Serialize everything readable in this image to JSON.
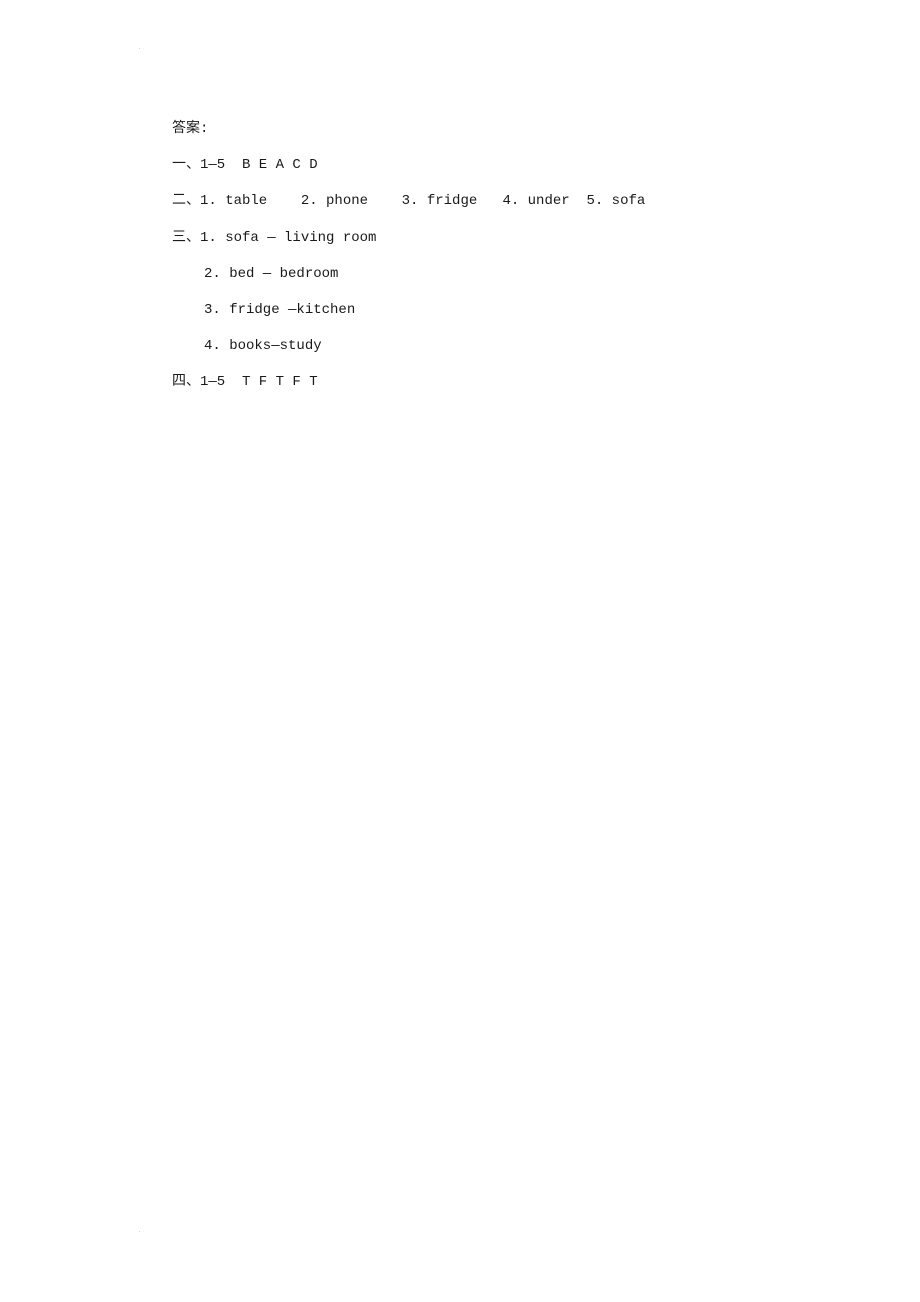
{
  "document": {
    "heading": "答案:",
    "sections": [
      {
        "label": "一、",
        "text": "1—5  B E A C D"
      },
      {
        "label": "二、",
        "text": "1. table    2. phone    3. fridge   4. under  5. sofa"
      },
      {
        "label": "三、",
        "text": "1. sofa — living room"
      },
      {
        "label": "",
        "text": "2. bed — bedroom"
      },
      {
        "label": "",
        "text": "3. fridge —kitchen"
      },
      {
        "label": "",
        "text": "4. books—study"
      },
      {
        "label": "四、",
        "text": "1—5  T F T F T"
      }
    ]
  }
}
